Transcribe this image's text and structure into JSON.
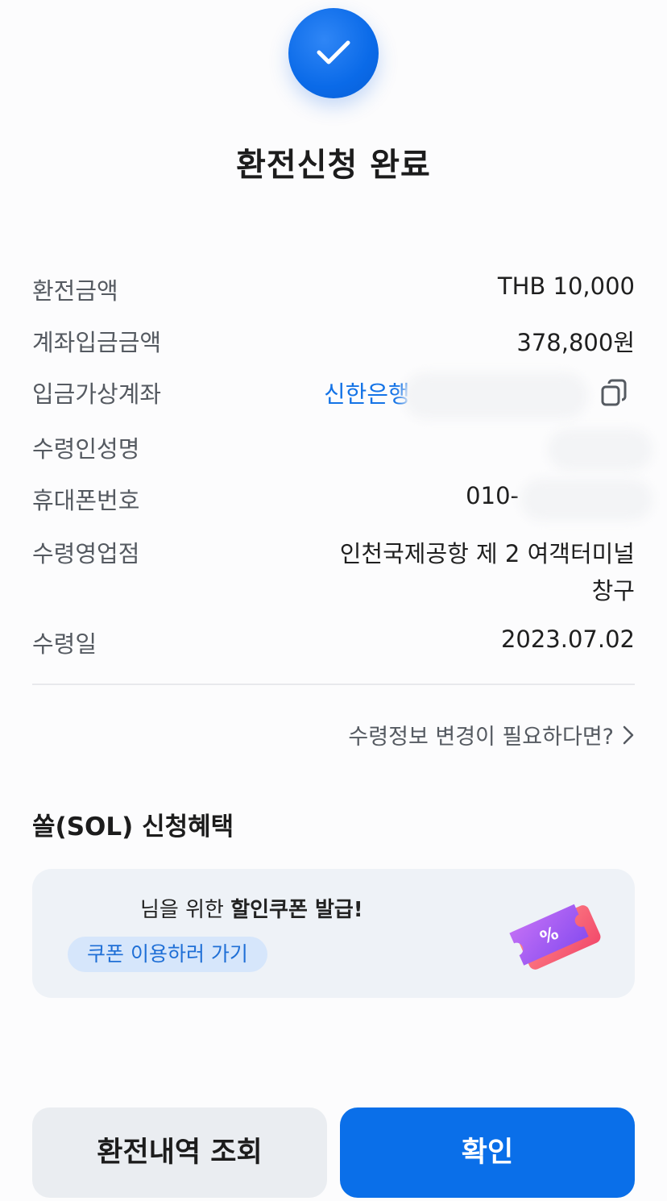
{
  "header": {
    "title": "환전신청 완료"
  },
  "details": {
    "amount_label": "환전금액",
    "amount_value": "THB 10,000",
    "deposit_label": "계좌입금금액",
    "deposit_value": "378,800원",
    "virtual_account_label": "입금가상계좌",
    "bank_name": "신한은행",
    "recipient_label": "수령인성명",
    "phone_label": "휴대폰번호",
    "phone_value": "010-",
    "branch_label": "수령영업점",
    "branch_line1": "인천국제공항 제 2 여객터미널",
    "branch_line2": "창구",
    "date_label": "수령일",
    "date_value": "2023.07.02"
  },
  "change_link": {
    "label": "수령정보 변경이 필요하다면?"
  },
  "benefits": {
    "section_title": "쏠(SOL) 신청혜택",
    "coupon_prefix": "님을 위한 ",
    "coupon_highlight": "할인쿠폰 발급!",
    "coupon_button": "쿠폰 이용하러 가기"
  },
  "buttons": {
    "history": "환전내역 조회",
    "confirm": "확인"
  },
  "colors": {
    "accent": "#0a6fe9",
    "link": "#1473e6",
    "secondary_button": "#eaedf1",
    "card_bg": "#eef2f7"
  },
  "icons": {
    "check": "check-icon",
    "copy": "copy-icon",
    "chevron": "chevron-right-icon",
    "ticket": "coupon-ticket-icon"
  }
}
